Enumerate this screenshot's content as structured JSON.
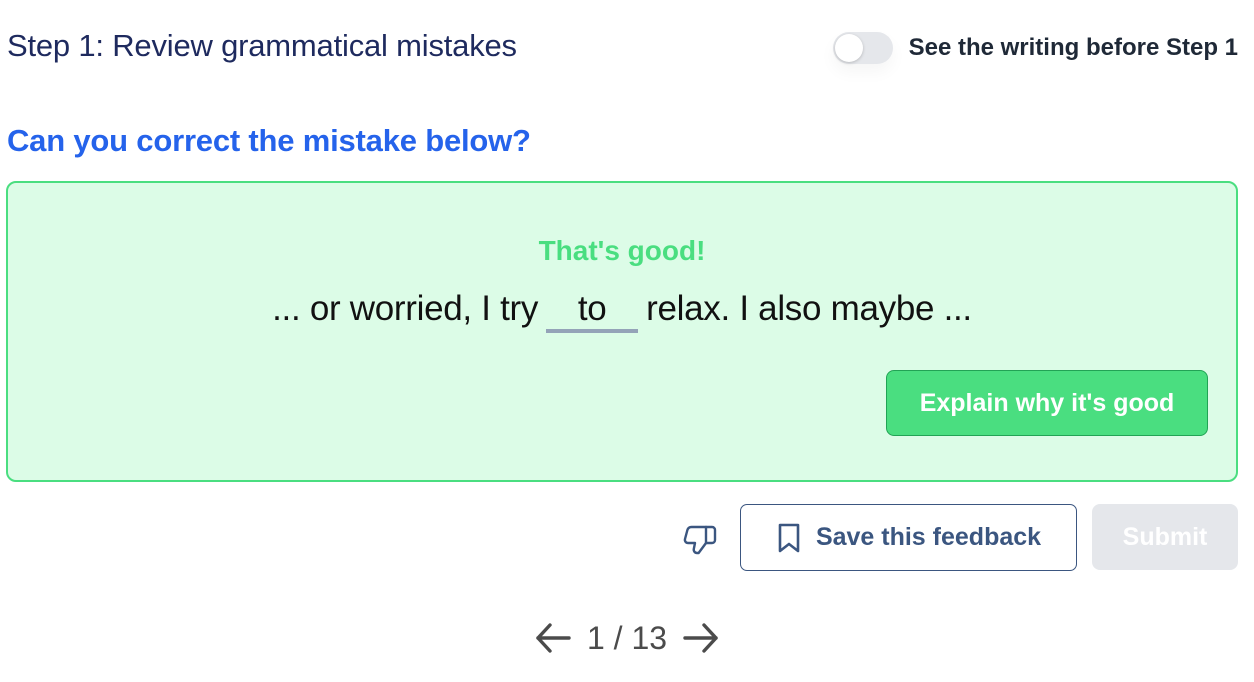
{
  "header": {
    "step_title": "Step 1: Review grammatical mistakes",
    "toggle_label": "See the writing before Step 1",
    "toggle_on": false
  },
  "question": "Can you correct the mistake below?",
  "feedback": {
    "status": "That's good!",
    "sentence_before": "... or worried, I try",
    "answer_value": "to",
    "sentence_after": "relax. I also maybe ...",
    "explain_label": "Explain why it's good"
  },
  "actions": {
    "dislike_icon": "thumbs-down-icon",
    "bookmark_icon": "bookmark-icon",
    "save_label": "Save this feedback",
    "submit_label": "Submit",
    "submit_disabled": true
  },
  "pagination": {
    "current": 1,
    "total": 13,
    "display": "1 / 13",
    "prev_icon": "arrow-left-icon",
    "next_icon": "arrow-right-icon"
  },
  "colors": {
    "title": "#1e2a5e",
    "question": "#2563eb",
    "success": "#4ade80",
    "success_bg": "#dcfce7",
    "outline_button": "#3b5680",
    "disabled": "#e5e7eb"
  }
}
